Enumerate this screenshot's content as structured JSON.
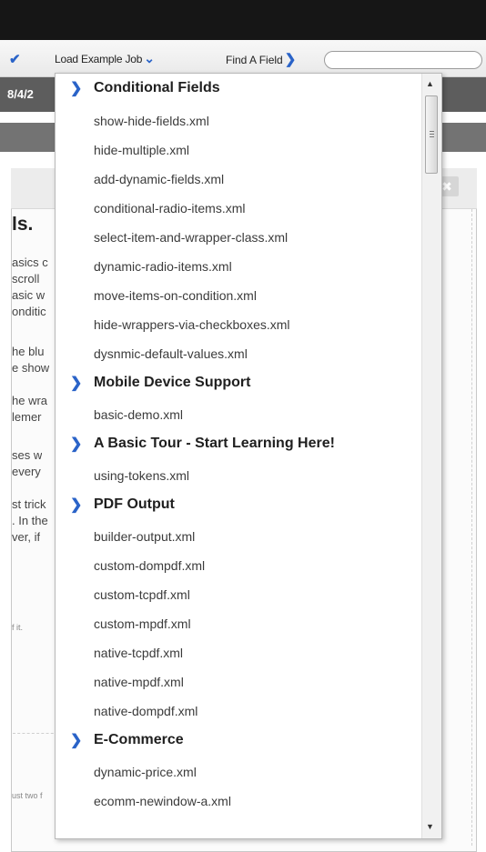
{
  "toolbar": {
    "load_label": "Load Example Job",
    "find_label": "Find A Field",
    "search_value": ""
  },
  "header": {
    "date": "8/4/2"
  },
  "background": {
    "title_fragment": "ls.",
    "lines": [
      "asics c",
      "scroll",
      "asic w",
      "onditic",
      "he blu",
      "e show",
      "he wra",
      "lemer",
      "ses w",
      " every",
      "st trick",
      ". In the",
      "ver, if"
    ],
    "small1": "f it.",
    "small2": "ust two f"
  },
  "dropdown": {
    "groups": [
      {
        "category": "Conditional Fields",
        "files": [
          "show-hide-fields.xml",
          "hide-multiple.xml",
          "add-dynamic-fields.xml",
          "conditional-radio-items.xml",
          "select-item-and-wrapper-class.xml",
          "dynamic-radio-items.xml",
          "move-items-on-condition.xml",
          "hide-wrappers-via-checkboxes.xml",
          "dysnmic-default-values.xml"
        ]
      },
      {
        "category": "Mobile Device Support",
        "files": [
          "basic-demo.xml"
        ]
      },
      {
        "category": "A Basic Tour - Start Learning Here!",
        "files": [
          "using-tokens.xml"
        ]
      },
      {
        "category": "PDF Output",
        "files": [
          "builder-output.xml",
          "custom-dompdf.xml",
          "custom-tcpdf.xml",
          "custom-mpdf.xml",
          "native-tcpdf.xml",
          "native-mpdf.xml",
          "native-dompdf.xml"
        ]
      },
      {
        "category": "E-Commerce",
        "files": [
          "dynamic-price.xml",
          "ecomm-newindow-a.xml"
        ]
      }
    ]
  },
  "colors": {
    "accent": "#2a63c8",
    "topbar": "#161616",
    "datebar": "#5d5d5d"
  },
  "icons": {
    "check": "check-icon",
    "chevron_down": "chevron-down-icon",
    "chevron_right": "chevron-right-icon",
    "close": "close-icon"
  }
}
